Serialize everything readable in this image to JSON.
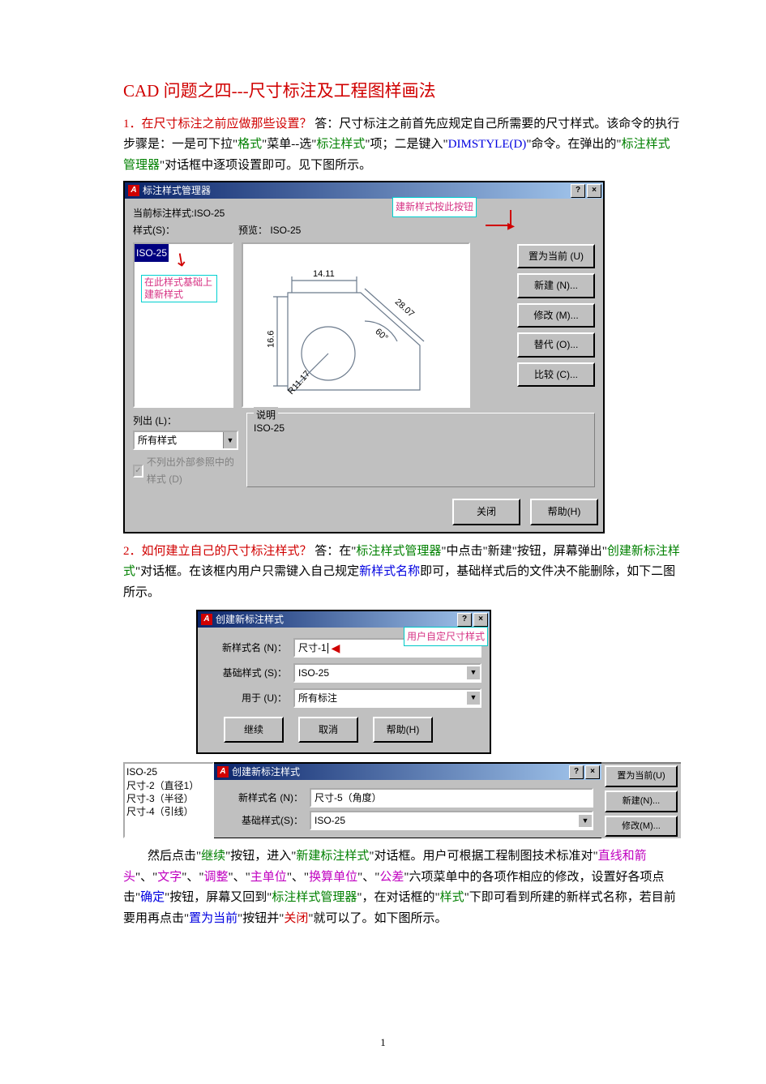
{
  "title": "CAD 问题之四---尺寸标注及工程图样画法",
  "q1": {
    "num": "1．",
    "question": "在尺寸标注之前应做那些设置？",
    "answer_prefix": " 答：尺寸标注之前首先应规定自己所需要的尺寸样式。该命令的执行步骤是：一是可下拉\"",
    "g1": "格式",
    "mid1": "\"菜单--选\"",
    "g2": "标注样式",
    "mid2": "\"项；二是键入\"",
    "b1": "DIMSTYLE(D)",
    "mid3": "\"命令。在弹出的\"",
    "g3": "标注样式管理器",
    "tail": "\"对话框中逐项设置即可。见下图所示。"
  },
  "dlg1": {
    "title": "标注样式管理器",
    "help_btn": "?",
    "close_btn": "×",
    "current": "当前标注样式:ISO-25",
    "styles_label": "样式(S)：",
    "selected_style": "ISO-25",
    "preview_label": "预览： ISO-25",
    "annot_top": "建新样式按此按钮",
    "annot_left": "在此样式基础上建新样式",
    "dims": {
      "d1": "14.11",
      "d2": "16.6",
      "d3": "28.07",
      "d4": "60",
      "d5": "R11.17"
    },
    "btns": {
      "set_current": "置为当前 (U)",
      "new": "新建 (N)...",
      "modify": "修改 (M)...",
      "override": "替代 (O)...",
      "compare": "比较 (C)..."
    },
    "list_label": "列出 (L)：",
    "list_value": "所有样式",
    "chk_label": "不列出外部参照中的样式 (D)",
    "desc_label": "说明",
    "desc_value": "ISO-25",
    "close": "关闭",
    "help": "帮助(H)"
  },
  "q2": {
    "num": "2．",
    "question": "如何建立自己的尺寸标注样式？",
    "answer_prefix": " 答：在\"",
    "g1": "标注样式管理器",
    "mid1": "\"中点击\"新建\"按钮，屏幕弹出\"",
    "g2": "创建新标注样式",
    "mid2": "\"对话框。在该框内用户只需键入自己规定",
    "b1": "新样式名称",
    "tail": "即可，基础样式后的文件决不能删除，如下二图所示。"
  },
  "dlg2": {
    "title": "创建新标注样式",
    "annot": "用户自定尺寸样式",
    "name_label": "新样式名 (N)：",
    "name_value": "尺寸-1",
    "base_label": "基础样式 (S)：",
    "base_value": "ISO-25",
    "usefor_label": "用于 (U)：",
    "usefor_value": "所有标注",
    "btn_continue": "继续",
    "btn_cancel": "取消",
    "btn_help": "帮助(H)"
  },
  "dlg3": {
    "list": [
      "ISO-25",
      "尺寸-2（直径1）",
      "尺寸-3（半径）",
      "尺寸-4（引线）"
    ],
    "title": "创建新标注样式",
    "name_label": "新样式名 (N)：",
    "name_value": "尺寸-5（角度）",
    "base_label": "基础样式(S)：",
    "base_value": "ISO-25",
    "btns": {
      "set_current": "置为当前(U)",
      "new": "新建(N)...",
      "modify": "修改(M)..."
    }
  },
  "para3": {
    "lead": "　　然后点击\"",
    "g1": "继续",
    "m1": "\"按钮，进入\"",
    "g2": "新建标注样式",
    "m2": "\"对话框。用户可根据工程制图技术标准对\"",
    "p1": "直线和箭头",
    "p2": "文字",
    "p3": "调整",
    "p4": "主单位",
    "p5": "换算单位",
    "p6": "公差",
    "m3": "\"六项菜单中的各项作相应的修改，设置好各项点击\"",
    "b1": "确定",
    "m4": "\"按钮，屏幕又回到\"",
    "g3": "标注样式管理器",
    "m5": "\"，在对话框的\"",
    "g4": "样式",
    "m6": "\"下即可看到所建的新样式名称，若目前要用再点击\"",
    "b2": "置为当前",
    "m7": "\"按钮并\"",
    "r1": "关闭",
    "m8": "\"就可以了。如下图所示。"
  },
  "page_num": "1"
}
